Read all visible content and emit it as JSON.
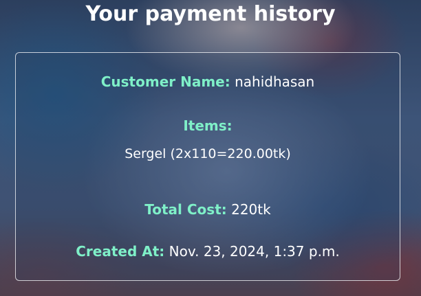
{
  "page": {
    "title": "Your payment history"
  },
  "payment": {
    "customer_label": "Customer Name:",
    "customer_value": "nahidhasan",
    "items_label": "Items:",
    "items": [
      "Sergel (2x110=220.00tk)"
    ],
    "total_label": "Total Cost:",
    "total_value": "220tk",
    "created_label": "Created At:",
    "created_value": "Nov. 23, 2024, 1:37 p.m."
  },
  "colors": {
    "label": "#7ff0c8",
    "text": "#ffffff",
    "card_border": "#ffffff"
  }
}
